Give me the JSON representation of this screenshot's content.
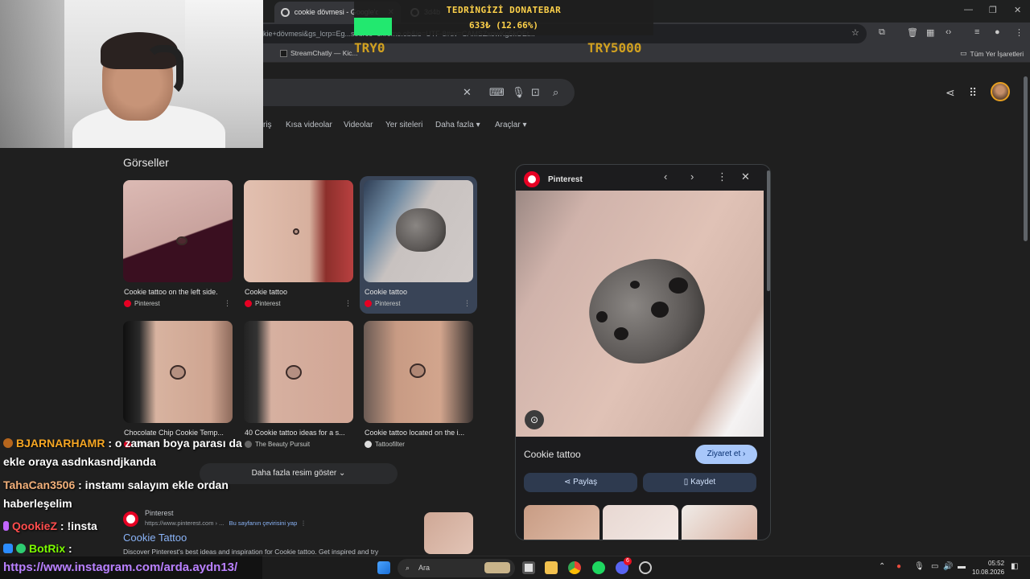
{
  "browser": {
    "tabs": [
      {
        "title": "cookie dövmesi - Google'da Ar"
      },
      {
        "title": "3d4b"
      }
    ],
    "omnibox": "okie+dövmesi&gs_lcrp=Eg...source=chrome.ob&ie=UTF-8#sv=CAMSZxowKg5kOEt...",
    "bookmarks": [
      {
        "label": "StreamChatly — Kic..."
      }
    ],
    "bookmarks_right": "Tüm Yer İşaretleri"
  },
  "overlay": {
    "donation_title": "TEDRİNGİZİ DONATEBAR",
    "donation_amount": "633₺ (12.66%)",
    "goal_min": "TRY0",
    "goal_max": "TRY5000",
    "progress_percent": 12.66
  },
  "google": {
    "nav_tabs": [
      "riş",
      "Kısa videolar",
      "Videolar",
      "Yer siteleri",
      "Daha fazla ▾",
      "Araçlar ▾"
    ],
    "section_title": "Görseller",
    "images": [
      {
        "title": "Cookie tattoo on the left side.",
        "source": "Pinterest"
      },
      {
        "title": "Cookie tattoo",
        "source": "Pinterest"
      },
      {
        "title": "Cookie tattoo",
        "source": "Pinterest"
      },
      {
        "title": "Chocolate Chip Cookie Temp...",
        "source": "Pinterest"
      },
      {
        "title": "40 Cookie tattoo ideas for a s...",
        "source": "The Beauty Pursuit"
      },
      {
        "title": "Cookie tattoo located on the i...",
        "source": "Tattoofilter"
      }
    ],
    "more_images": "Daha fazla resim göster",
    "result": {
      "site": "Pinterest",
      "url": "https://www.pinterest.com ›  ...",
      "translate": "Bu sayfanın çevirisini yap",
      "title": "Cookie Tattoo",
      "snippet": "Discover Pinterest's best ideas and inspiration for Cookie tattoo. Get inspired and try"
    }
  },
  "panel": {
    "source": "Pinterest",
    "title": "Cookie tattoo",
    "visit": "Ziyaret et",
    "share": "Paylaş",
    "save": "Kaydet"
  },
  "chat": [
    {
      "user": "BJARNARHAMR",
      "text": ": o zaman boya parası da ekle oraya asdnkasndjkanda",
      "color": "#f5a623"
    },
    {
      "user": "TahaCan3506",
      "text": ": instamı salayım ekle ordan haberleşelim",
      "color": "#f2b07a"
    },
    {
      "user": "QookieZ",
      "text": ": !insta",
      "color": "#ff4d4d"
    },
    {
      "user": "BotRix",
      "text": ":",
      "color": "#7cfc00"
    }
  ],
  "chat_link": "https://www.instagram.com/arda.aydn13/",
  "taskbar": {
    "search": "Ara",
    "time": "05:52",
    "date": "10.08.2026",
    "discord_badge": "6"
  }
}
